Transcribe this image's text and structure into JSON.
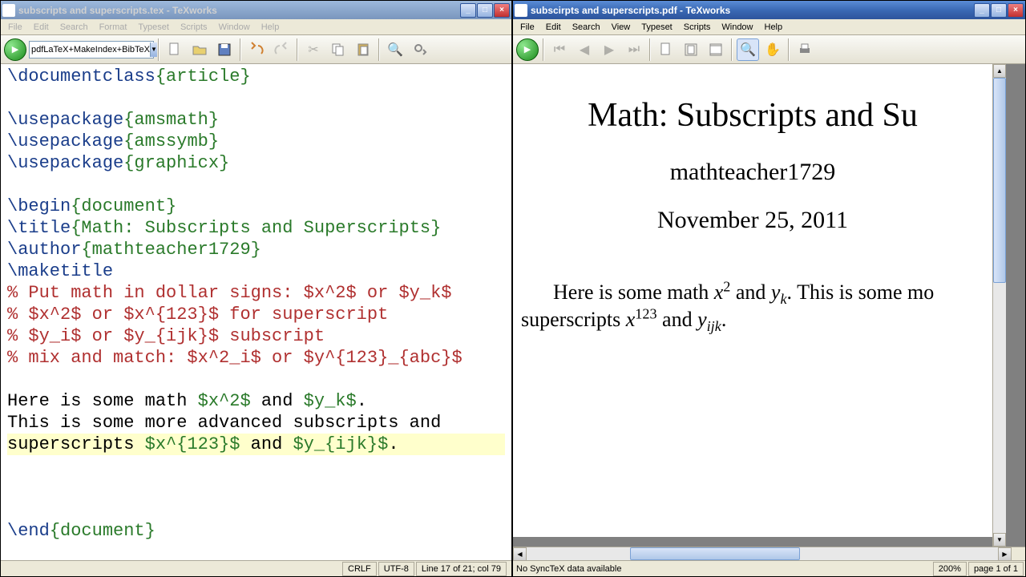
{
  "left": {
    "title": "subscripts and superscripts.tex - TeXworks",
    "menus": [
      "File",
      "Edit",
      "Search",
      "Format",
      "Typeset",
      "Scripts",
      "Window",
      "Help"
    ],
    "typeset_combo": "pdfLaTeX+MakeIndex+BibTeX",
    "status": {
      "crlf": "CRLF",
      "enc": "UTF-8",
      "pos": "Line 17 of 21; col 79"
    },
    "code": {
      "l1": "\\documentclass",
      "l1b": "{article}",
      "l2": "\\usepackage",
      "l2b": "{amsmath}",
      "l3": "\\usepackage",
      "l3b": "{amssymb}",
      "l4": "\\usepackage",
      "l4b": "{graphicx}",
      "l5": "\\begin",
      "l5b": "{document}",
      "l6": "\\title",
      "l6b": "{Math: Subscripts and Superscripts}",
      "l7": "\\author",
      "l7b": "{mathteacher1729}",
      "l8": "\\maketitle",
      "c1": "% Put math in dollar signs: $x^2$ or $y_k$",
      "c2": "% $x^2$ or $x^{123}$ for superscript",
      "c3": "% $y_i$ or $y_{ijk}$ subscript",
      "c4": "% mix and match: $x^2_i$ or $y^{123}_{abc}$",
      "t1a": "Here is some math ",
      "t1b": "$x^2$",
      "t1c": " and ",
      "t1d": "$y_k$",
      "t1e": ".",
      "t2a": "This is some more advanced subscripts and ",
      "t3a": "superscripts ",
      "t3b": "$x^{123}$",
      "t3c": " and ",
      "t3d": "$y_{ijk}$",
      "t3e": ".",
      "l9": "\\end",
      "l9b": "{document}"
    }
  },
  "right": {
    "title": "subscirpts and superscripts.pdf - TeXworks",
    "menus": [
      "File",
      "Edit",
      "Search",
      "View",
      "Typeset",
      "Scripts",
      "Window",
      "Help"
    ],
    "pdf": {
      "title": "Math: Subscripts and Su",
      "author": "mathteacher1729",
      "date": "November 25, 2011",
      "body1_pre": "Here is some math ",
      "body1_mid": " and ",
      "body1_post": ".  This is some mo",
      "body2_pre": "superscripts ",
      "body2_mid": " and ",
      "body2_post": "."
    },
    "status": {
      "sync": "No SyncTeX data available",
      "zoom": "200%",
      "page": "page 1 of 1"
    }
  }
}
